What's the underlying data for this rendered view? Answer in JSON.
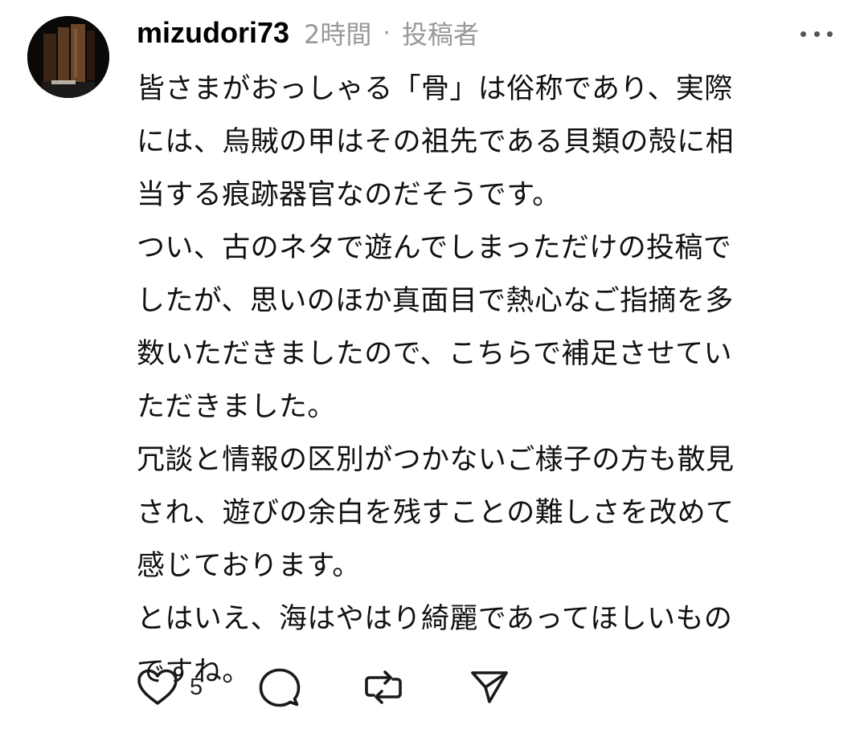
{
  "post": {
    "username": "mizudori73",
    "time": "2時間",
    "separator": "·",
    "author_tag": "投稿者",
    "lines": [
      "皆さまがおっしゃる「骨」は俗称であり、実際",
      "には、烏賊の甲はその祖先である貝類の殻に相",
      "当する痕跡器官なのだそうです。",
      "つい、古のネタで遊んでしまっただけの投稿で",
      "したが、思いのほか真面目で熱心なご指摘を多",
      "数いただきましたので、こちらで補足させてい",
      "ただきました。",
      "冗談と情報の区別がつかないご様子の方も散見",
      "され、遊びの余白を残すことの難しさを改めて",
      "感じております。",
      "とはいえ、海はやはり綺麗であってほしいもの",
      "ですね。"
    ],
    "like_count": "5"
  },
  "icons": {
    "avatar": "avatar-photo",
    "more": "more-horizontal-icon",
    "like": "heart-icon",
    "reply": "comment-icon",
    "repost": "repost-icon",
    "share": "send-icon"
  },
  "colors": {
    "meta_text": "#999999",
    "icon_stroke": "#1a1a1a"
  }
}
